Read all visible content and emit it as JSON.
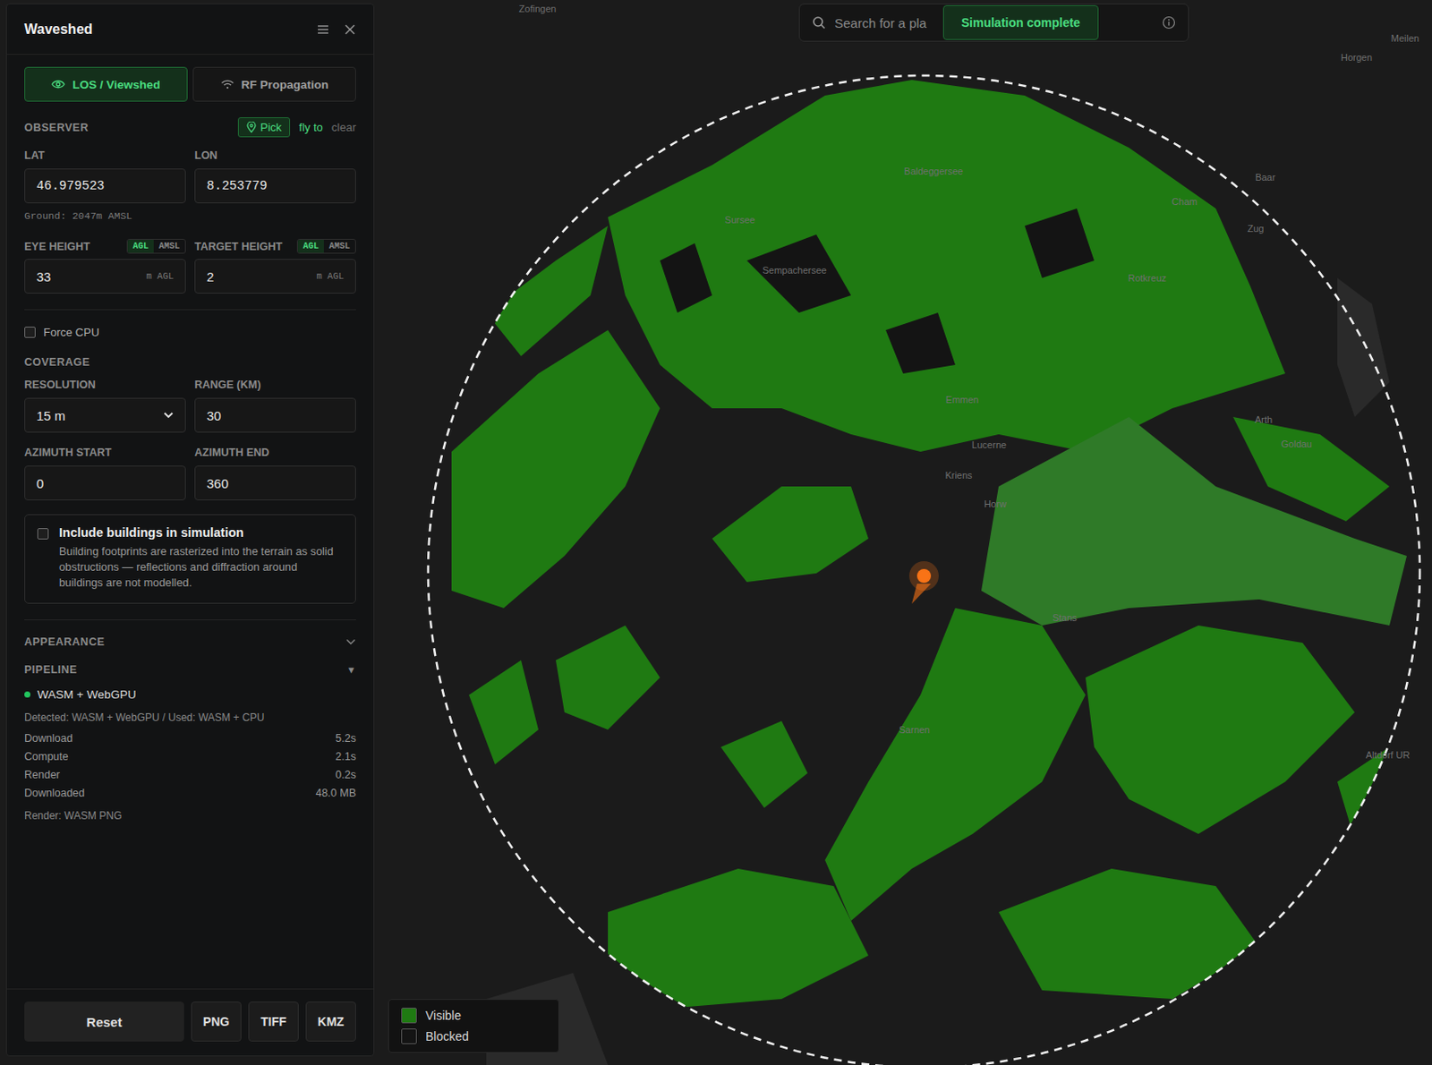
{
  "panel": {
    "title": "Waveshed"
  },
  "tabs": [
    {
      "label": "LOS / Viewshed",
      "selected": true
    },
    {
      "label": "RF Propagation",
      "selected": false
    }
  ],
  "observer": {
    "heading": "OBSERVER",
    "actions": [
      {
        "label": "Pick",
        "kind": "button"
      },
      {
        "label": "fly to",
        "kind": "link"
      },
      {
        "label": "clear",
        "kind": "muted"
      }
    ],
    "fields": [
      {
        "label": "LAT",
        "value": "46.979523"
      },
      {
        "label": "LON",
        "value": "8.253779"
      }
    ],
    "ground": "Ground: 2047m AMSL"
  },
  "heights": [
    {
      "label": "EYE HEIGHT",
      "modes": [
        {
          "label": "AGL",
          "selected": true
        },
        {
          "label": "AMSL",
          "selected": false
        }
      ],
      "value": "33",
      "unit": "m AGL"
    },
    {
      "label": "TARGET HEIGHT",
      "modes": [
        {
          "label": "AGL",
          "selected": true
        },
        {
          "label": "AMSL",
          "selected": false
        }
      ],
      "value": "2",
      "unit": "m AGL"
    }
  ],
  "force_cpu": {
    "label": "Force CPU",
    "checked": false
  },
  "coverage": {
    "heading": "COVERAGE",
    "fields": [
      {
        "label": "RESOLUTION",
        "value": "15 m",
        "kind": "select"
      },
      {
        "label": "RANGE (KM)",
        "value": "30",
        "kind": "input"
      },
      {
        "label": "AZIMUTH START",
        "value": "0",
        "kind": "input"
      },
      {
        "label": "AZIMUTH END",
        "value": "360",
        "kind": "input"
      }
    ]
  },
  "buildings": {
    "label": "Include buildings in simulation",
    "description": "Building footprints are rasterized into the terrain as solid obstructions — reflections and diffraction around buildings are not modelled.",
    "checked": false
  },
  "appearance": {
    "label": "APPEARANCE",
    "expanded": false
  },
  "pipeline": {
    "label": "PIPELINE",
    "toggle": "▼",
    "expanded": true,
    "status": {
      "label": "WASM + WebGPU",
      "color": "#22c55e"
    },
    "detected": "Detected: WASM + WebGPU / Used: WASM + CPU",
    "stats": [
      {
        "label": "Download",
        "value": "5.2s"
      },
      {
        "label": "Compute",
        "value": "2.1s"
      },
      {
        "label": "Render",
        "value": "0.2s"
      },
      {
        "label": "Downloaded",
        "value": "48.0 MB"
      }
    ],
    "render": "Render: WASM PNG"
  },
  "footer_buttons": [
    "Reset",
    "PNG",
    "TIFF",
    "KMZ"
  ],
  "search": {
    "placeholder": "Search for a pla"
  },
  "toast": "Simulation complete",
  "legend": [
    {
      "label": "Visible",
      "color": "#1f7a12"
    },
    {
      "label": "Blocked",
      "color": "#141414"
    }
  ],
  "map": {
    "labels": [
      "Zofingen",
      "Horgen",
      "Meilen",
      "Baar",
      "Cham",
      "Zug",
      "Rotkreuz",
      "Sursee",
      "Emmen",
      "Lucerne",
      "Kriens",
      "Horw",
      "Stans",
      "Sarnen",
      "Arth",
      "Goldau",
      "Baldeggersee",
      "Sempachersee",
      "Altdorf UR"
    ]
  }
}
